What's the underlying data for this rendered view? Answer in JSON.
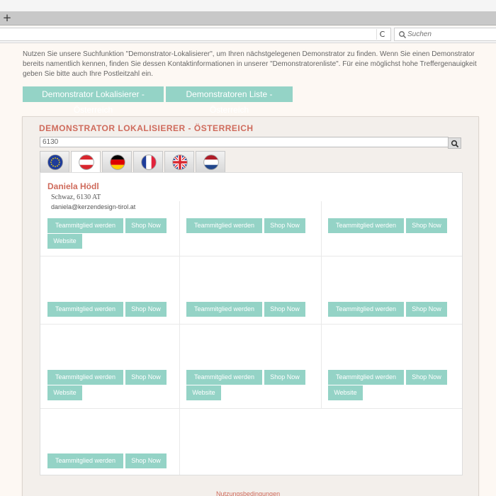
{
  "browser": {
    "newtab_symbol": "+",
    "reload_symbol": "C",
    "search_placeholder": "Suchen"
  },
  "intro": {
    "text": "Nutzen Sie unsere Suchfunktion \"Demonstrator-Lokalisierer\", um Ihren nächstgelegenen Demonstrator zu finden. Wenn Sie einen Demonstrator bereits namentlich kennen, finden Sie dessen Kontaktinformationen in unserer \"Demonstratorenliste\". Für eine möglichst hohe Treffergenauigkeit geben Sie bitte auch Ihre Postleitzahl ein."
  },
  "buttons": {
    "locator": "Demonstrator Lokalisierer - Österreich",
    "list": "Demonstratoren Liste - Österreich"
  },
  "panel": {
    "title": "DEMONSTRATOR LOKALISIERER - ÖSTERREICH",
    "zip_value": "6130"
  },
  "flags": [
    {
      "name": "eu",
      "colors": [
        "#1f3d9a",
        "#f5d20c"
      ]
    },
    {
      "name": "austria",
      "colors": [
        "#d9262e",
        "#ffffff"
      ]
    },
    {
      "name": "germany",
      "colors": [
        "#000000",
        "#dd0000",
        "#ffce00"
      ]
    },
    {
      "name": "france",
      "colors": [
        "#1f3d9a",
        "#ffffff",
        "#e2233b"
      ]
    },
    {
      "name": "uk",
      "colors": [
        "#1f3d9a",
        "#ffffff",
        "#d9262e"
      ]
    },
    {
      "name": "netherlands",
      "colors": [
        "#ae1c28",
        "#ffffff",
        "#21468b"
      ]
    }
  ],
  "result_buttons": {
    "team": "Teammitglied werden",
    "shop": "Shop Now",
    "website": "Website"
  },
  "demonstrator": {
    "name": "Daniela Hödl",
    "city": "Schwaz, 6130 AT",
    "email": "daniela@kerzendesign-tirol.at"
  },
  "footer": {
    "terms": "Nutzungsbedingungen"
  },
  "colors": {
    "accent": "#94d3c6",
    "title": "#cf6b5c"
  }
}
